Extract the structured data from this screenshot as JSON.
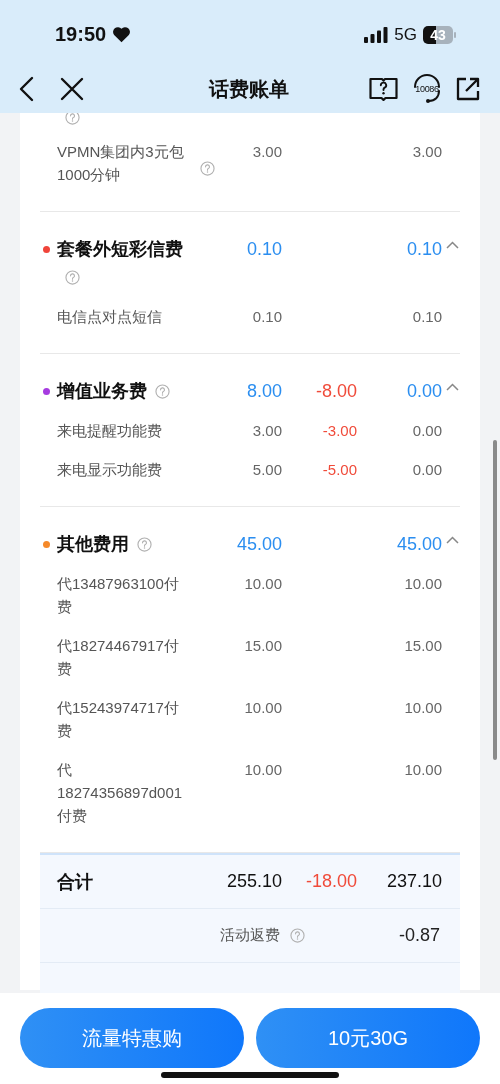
{
  "status_bar": {
    "time": "19:50",
    "network": "5G",
    "battery": "43"
  },
  "nav": {
    "title": "话费账单",
    "service_number": "10086"
  },
  "partial_group": {
    "help": true,
    "items": [
      {
        "label": "VPMN集团内3元包1000分钟",
        "help": true,
        "amount": "3.00",
        "final": "3.00"
      }
    ]
  },
  "groups": [
    {
      "name": "套餐外短彩信费",
      "color": "#f0443a",
      "help": true,
      "amount": "0.10",
      "final": "0.10",
      "expanded": true,
      "items": [
        {
          "label": "电信点对点短信",
          "amount": "0.10",
          "final": "0.10"
        }
      ]
    },
    {
      "name": "增值业务费",
      "color": "#a63be0",
      "help": true,
      "amount": "8.00",
      "discount": "-8.00",
      "final": "0.00",
      "expanded": true,
      "items": [
        {
          "label": "来电提醒功能费",
          "amount": "3.00",
          "discount": "-3.00",
          "final": "0.00"
        },
        {
          "label": "来电显示功能费",
          "amount": "5.00",
          "discount": "-5.00",
          "final": "0.00"
        }
      ]
    },
    {
      "name": "其他费用",
      "color": "#f5892a",
      "help": true,
      "amount": "45.00",
      "final": "45.00",
      "expanded": true,
      "items": [
        {
          "label": "代13487963100付费",
          "amount": "10.00",
          "final": "10.00"
        },
        {
          "label": "代18274467917付费",
          "amount": "15.00",
          "final": "15.00"
        },
        {
          "label": "代15243974717付费",
          "amount": "10.00",
          "final": "10.00"
        },
        {
          "label": "代18274356897d001付费",
          "amount": "10.00",
          "final": "10.00"
        }
      ]
    }
  ],
  "totals": [
    {
      "kind": "sum",
      "label": "合计",
      "amount": "255.10",
      "discount": "-18.00",
      "final": "237.10"
    },
    {
      "kind": "adjust",
      "label": "活动返费",
      "help": true,
      "final": "-0.87"
    }
  ],
  "actions": [
    "流量特惠购",
    "10元30G"
  ]
}
